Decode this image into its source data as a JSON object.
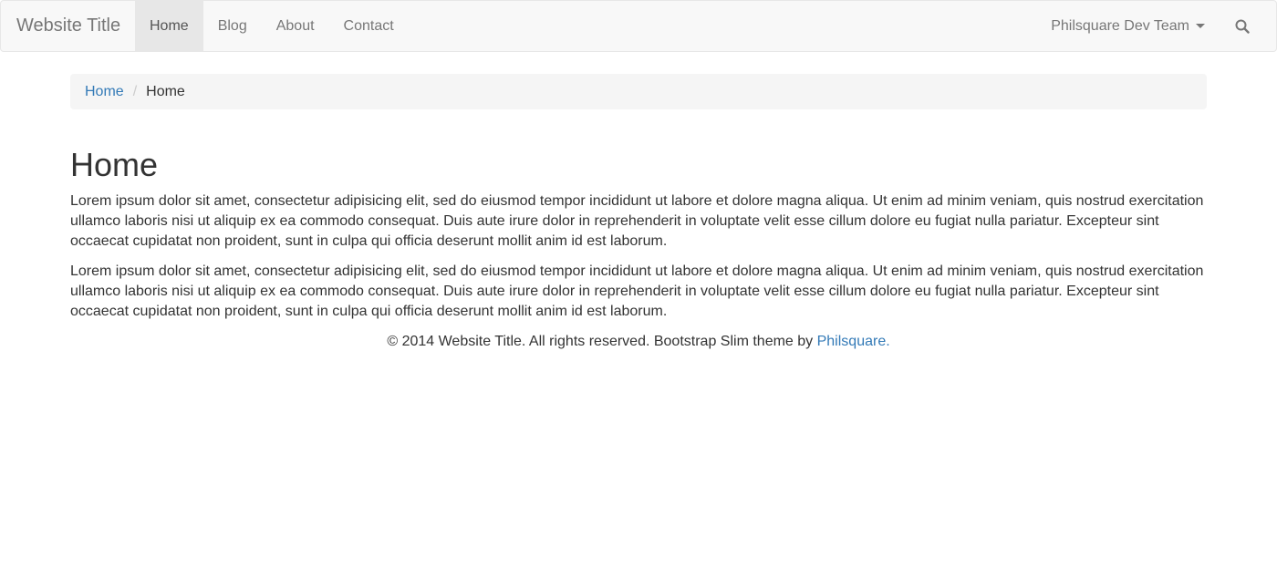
{
  "navbar": {
    "brand": "Website Title",
    "items": [
      {
        "label": "Home",
        "active": true
      },
      {
        "label": "Blog",
        "active": false
      },
      {
        "label": "About",
        "active": false
      },
      {
        "label": "Contact",
        "active": false
      }
    ],
    "dropdown_label": "Philsquare Dev Team",
    "search_icon": "search-icon"
  },
  "breadcrumb": {
    "link": "Home",
    "separator": "/",
    "current": "Home"
  },
  "main": {
    "title": "Home",
    "paragraphs": [
      "Lorem ipsum dolor sit amet, consectetur adipisicing elit, sed do eiusmod tempor incididunt ut labore et dolore magna aliqua. Ut enim ad minim veniam, quis nostrud exercitation ullamco laboris nisi ut aliquip ex ea commodo consequat. Duis aute irure dolor in reprehenderit in voluptate velit esse cillum dolore eu fugiat nulla pariatur. Excepteur sint occaecat cupidatat non proident, sunt in culpa qui officia deserunt mollit anim id est laborum.",
      "Lorem ipsum dolor sit amet, consectetur adipisicing elit, sed do eiusmod tempor incididunt ut labore et dolore magna aliqua. Ut enim ad minim veniam, quis nostrud exercitation ullamco laboris nisi ut aliquip ex ea commodo consequat. Duis aute irure dolor in reprehenderit in voluptate velit esse cillum dolore eu fugiat nulla pariatur. Excepteur sint occaecat cupidatat non proident, sunt in culpa qui officia deserunt mollit anim id est laborum."
    ]
  },
  "footer": {
    "text": "© 2014 Website Title. All rights reserved. Bootstrap Slim theme by ",
    "link": "Philsquare."
  },
  "colors": {
    "navbar_bg": "#f8f8f8",
    "active_bg": "#e7e7e7",
    "link": "#337ab7",
    "text": "#333333",
    "muted": "#777777"
  }
}
